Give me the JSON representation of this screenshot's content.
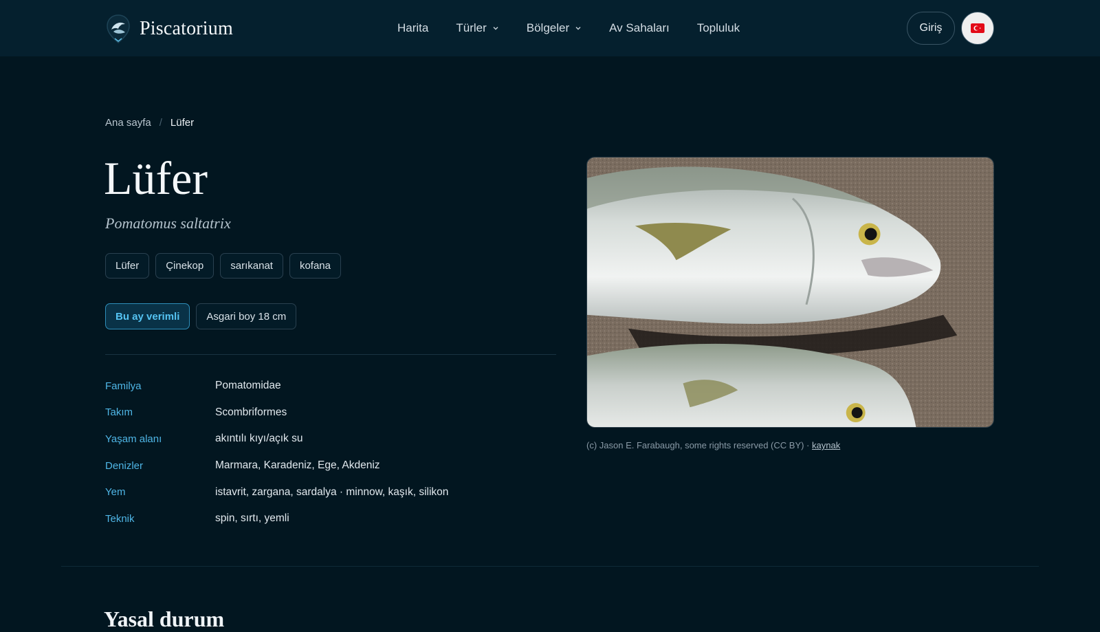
{
  "header": {
    "brand": "Piscatorium",
    "nav": [
      {
        "label": "Harita",
        "has_dropdown": false
      },
      {
        "label": "Türler",
        "has_dropdown": true
      },
      {
        "label": "Bölgeler",
        "has_dropdown": true
      },
      {
        "label": "Av Sahaları",
        "has_dropdown": false
      },
      {
        "label": "Topluluk",
        "has_dropdown": false
      }
    ],
    "login_label": "Giriş",
    "language_flag": "turkey-flag-icon"
  },
  "breadcrumb": {
    "home": "Ana sayfa",
    "separator": "/",
    "current": "Lüfer"
  },
  "species": {
    "name": "Lüfer",
    "scientific_name": "Pomatomus saltatrix",
    "aliases": [
      "Lüfer",
      "Çinekop",
      "sarıkanat",
      "kofana"
    ],
    "badges": {
      "season": "Bu ay verimli",
      "min_size": "Asgari boy 18 cm"
    },
    "info": [
      {
        "label": "Familya",
        "value": "Pomatomidae"
      },
      {
        "label": "Takım",
        "value": "Scombriformes"
      },
      {
        "label": "Yaşam alanı",
        "value": "akıntılı kıyı/açık su"
      },
      {
        "label": "Denizler",
        "value": "Marmara, Karadeniz, Ege, Akdeniz"
      },
      {
        "label": "Yem",
        "value": "istavrit, zargana, sardalya · minnow, kaşık, silikon"
      },
      {
        "label": "Teknik",
        "value": "spin, sırtı, yemli"
      }
    ]
  },
  "photo": {
    "credit": "(c) Jason E. Farabaugh, some rights reserved (CC BY) · ",
    "credit_link": "kaynak"
  },
  "next_section_title": "Yasal durum",
  "colors": {
    "background": "#021620",
    "header": "#05202e",
    "accent": "#4fb6e6",
    "badge_accent": "#55c3f2"
  }
}
